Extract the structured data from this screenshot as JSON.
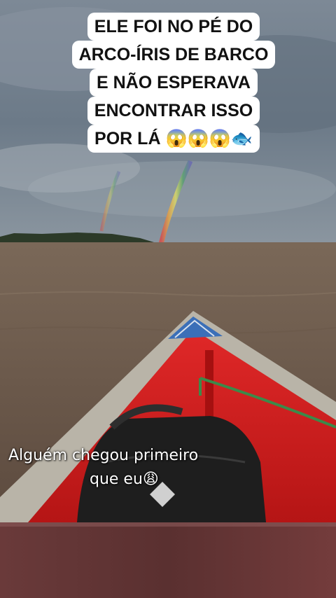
{
  "caption": {
    "lines": [
      "ELE FOI NO PÉ DO",
      "ARCO-ÍRIS DE BARCO",
      "E NÃO ESPERAVA",
      "ENCONTRAR ISSO",
      "POR LÁ 😱😱😱🐟"
    ]
  },
  "overlay": {
    "line1": "Alguém chegou primeiro",
    "line2": "que eu",
    "emoji": "😩"
  }
}
